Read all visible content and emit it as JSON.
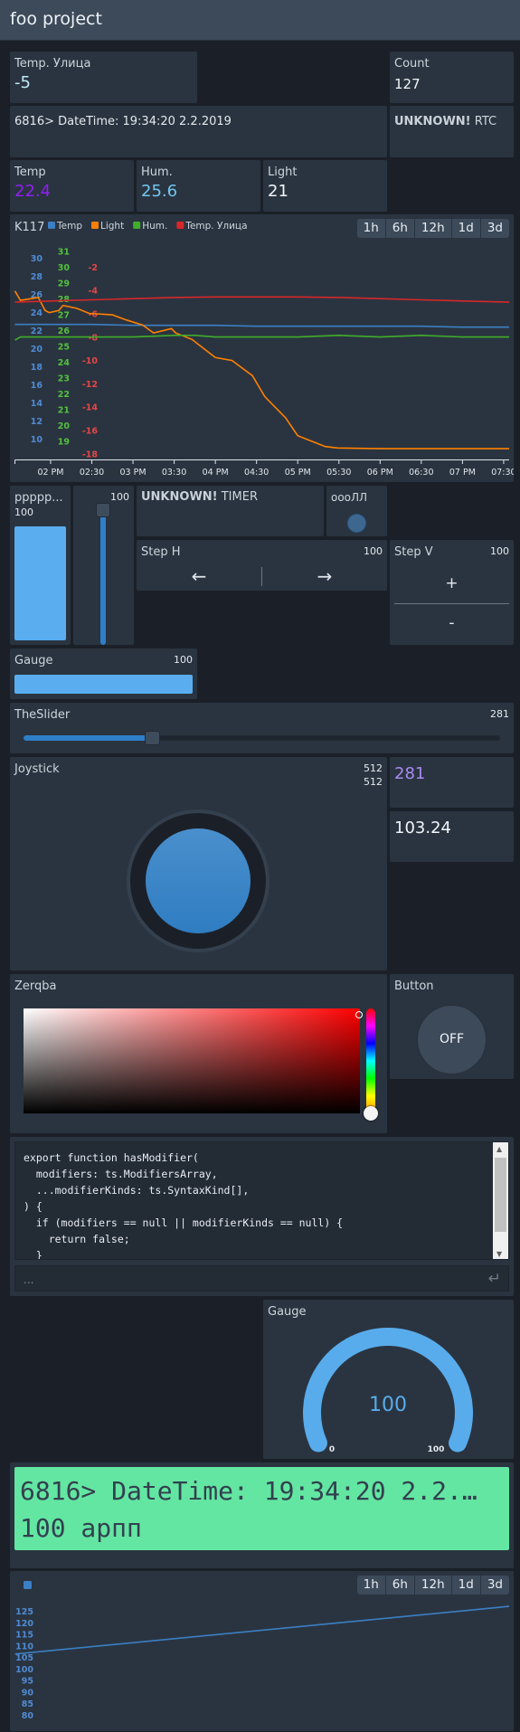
{
  "header": {
    "title": "foo project"
  },
  "widgets": {
    "temp_outside": {
      "label": "Temp. Улица",
      "value": "-5"
    },
    "count": {
      "label": "Count",
      "value": "127"
    },
    "datetime": {
      "text": "6816> DateTime: 19:34:20 2.2.2019"
    },
    "rtc": {
      "status": "UNKNOWN!",
      "label": "RTC"
    },
    "temp": {
      "label": "Temp",
      "value": "22.4",
      "color": "#8f1ff0"
    },
    "hum": {
      "label": "Hum.",
      "value": "25.6",
      "color": "#74c6f0"
    },
    "light": {
      "label": "Light",
      "value": "21"
    },
    "vbar": {
      "label": "ppppp...",
      "value": "100",
      "level_percent": 100
    },
    "vslider": {
      "value": "100",
      "level_percent": 100
    },
    "timer": {
      "status": "UNKNOWN!",
      "label": "TIMER"
    },
    "led": {
      "label": "оооЛЛ",
      "color": "#3e6790"
    },
    "step_h": {
      "label": "Step H",
      "value": "100",
      "left": "←",
      "right": "→"
    },
    "step_v": {
      "label": "Step V",
      "value": "100",
      "plus": "+",
      "minus": "-"
    },
    "gauge_bar": {
      "label": "Gauge",
      "value": "100",
      "level_percent": 100
    },
    "slider": {
      "label": "TheSlider",
      "value": "281",
      "level_percent": 27
    },
    "joystick": {
      "label": "Joystick",
      "x": "512",
      "y": "512"
    },
    "value_281": {
      "value": "281",
      "color": "#a78af2"
    },
    "value_103": {
      "value": "103.24"
    },
    "color_picker": {
      "label": "Zerqba",
      "hue_color": "#ff0000"
    },
    "button": {
      "label": "Button",
      "state": "OFF"
    },
    "terminal": {
      "code": "export function hasModifier(\n  modifiers: ts.ModifiersArray,\n  ...modifierKinds: ts.SyntaxKind[],\n) {\n  if (modifiers == null || modifierKinds == null) {\n    return false;\n  }",
      "placeholder": "...",
      "enter_icon": "enter-icon"
    },
    "gauge": {
      "label": "Gauge",
      "value": "100",
      "min": "0",
      "max": "100",
      "level_percent": 100,
      "color": "#58acec"
    },
    "lcd": {
      "line1": "6816> DateTime: 19:34:20 2.2.…",
      "line2": "100 арпп",
      "color": "#63e6a2"
    }
  },
  "chart_data": [
    {
      "type": "line",
      "title": "K117",
      "legend": "top-left",
      "range_buttons": [
        "1h",
        "6h",
        "12h",
        "1d",
        "3d"
      ],
      "x_range": [
        "13:34",
        "19:34"
      ],
      "x_ticks": [
        {
          "t": "14:00",
          "label": "02 PM"
        },
        {
          "t": "14:30",
          "label": "02:30"
        },
        {
          "t": "15:00",
          "label": "03 PM"
        },
        {
          "t": "15:30",
          "label": "03:30"
        },
        {
          "t": "16:00",
          "label": "04 PM"
        },
        {
          "t": "16:30",
          "label": "04:30"
        },
        {
          "t": "17:00",
          "label": "05 PM"
        },
        {
          "t": "17:30",
          "label": "05:30"
        },
        {
          "t": "18:00",
          "label": "06 PM"
        },
        {
          "t": "18:30",
          "label": "06:30"
        },
        {
          "t": "19:00",
          "label": "07 PM"
        },
        {
          "t": "19:30",
          "label": "07:30"
        }
      ],
      "series": [
        {
          "name": "Temp",
          "color": "#3b7fc4",
          "tick_color": "#4f8bd4",
          "ylim": [
            8,
            32
          ],
          "ticks": [
            30,
            28,
            26,
            24,
            22,
            20,
            18,
            16,
            14,
            12,
            10
          ],
          "x": [
            "13:34",
            "14:00",
            "14:30",
            "15:00",
            "15:30",
            "16:00",
            "16:30",
            "17:00",
            "17:30",
            "18:00",
            "18:30",
            "19:00",
            "19:34"
          ],
          "y": [
            22.7,
            22.7,
            22.7,
            22.6,
            22.6,
            22.6,
            22.5,
            22.5,
            22.5,
            22.5,
            22.5,
            22.4,
            22.4
          ]
        },
        {
          "name": "Light",
          "color": "#ff8000",
          "ylim": [
            10,
            310
          ],
          "ticks": [],
          "x": [
            "13:34",
            "13:38",
            "13:51",
            "13:56",
            "13:59",
            "14:06",
            "14:09",
            "14:19",
            "14:28",
            "14:45",
            "14:55",
            "15:07",
            "15:15",
            "15:28",
            "15:31",
            "15:43",
            "16:00",
            "16:12",
            "16:27",
            "16:36",
            "16:51",
            "17:00",
            "17:20",
            "17:29",
            "18:00",
            "18:30",
            "19:00",
            "19:34"
          ],
          "y": [
            240,
            227,
            231,
            213,
            210,
            213,
            220,
            216,
            209,
            207,
            200,
            193,
            182,
            188,
            182,
            173,
            148,
            144,
            123,
            94,
            65,
            40,
            25,
            23,
            22,
            22,
            22,
            22
          ]
        },
        {
          "name": "Hum.",
          "color": "#3fae2a",
          "tick_color": "#52c23c",
          "ylim": [
            18,
            31.7
          ],
          "ticks": [
            31,
            30,
            29,
            28,
            27,
            26,
            25,
            24,
            23,
            22,
            21,
            20,
            19
          ],
          "x": [
            "13:34",
            "13:38",
            "14:00",
            "14:30",
            "15:00",
            "15:30",
            "15:45",
            "16:00",
            "16:30",
            "17:00",
            "17:30",
            "18:00",
            "18:30",
            "19:00",
            "19:34"
          ],
          "y": [
            25.4,
            25.6,
            25.6,
            25.6,
            25.6,
            25.7,
            25.7,
            25.6,
            25.6,
            25.6,
            25.7,
            25.6,
            25.7,
            25.6,
            25.6
          ]
        },
        {
          "name": "Temp. Улица",
          "color": "#d62728",
          "tick_color": "#e84545",
          "ylim": [
            -18.3,
            0.3
          ],
          "ticks": [
            -2,
            -4,
            -6,
            -8,
            -10,
            -12,
            -14,
            -16,
            -18
          ],
          "x": [
            "13:34",
            "14:00",
            "14:30",
            "15:00",
            "15:30",
            "16:00",
            "17:00",
            "17:30",
            "18:00",
            "18:30",
            "19:00",
            "19:34"
          ],
          "y": [
            -5.0,
            -4.9,
            -4.8,
            -4.7,
            -4.6,
            -4.55,
            -4.55,
            -4.6,
            -4.7,
            -4.8,
            -4.9,
            -5.0
          ]
        }
      ]
    },
    {
      "type": "line",
      "legend": "top-left",
      "range_buttons": [
        "1h",
        "6h",
        "12h",
        "1d",
        "3d"
      ],
      "ylim": [
        76,
        130
      ],
      "y_ticks": [
        125,
        120,
        115,
        110,
        105,
        100,
        95,
        90,
        85,
        80
      ],
      "series": [
        {
          "color": "#3b7fc4",
          "values": [
            106.5,
            127.2
          ]
        }
      ]
    }
  ]
}
